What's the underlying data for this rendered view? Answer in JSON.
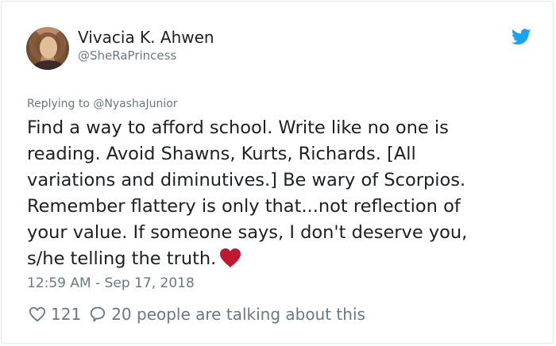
{
  "author": {
    "name": "Vivacia K. Ahwen",
    "handle": "@SheRaPrincess",
    "avatar_icon": "avatar-photo"
  },
  "brand": {
    "icon": "twitter-bird-icon",
    "color": "#1da1f2"
  },
  "tweet": {
    "replying_to": "Replying to @NyashaJunior",
    "lines": [
      "Find a way to afford school. Write like no one is",
      "reading. Avoid Shawns, Kurts, Richards. [All",
      "variations and diminutives.] Be wary of Scorpios.",
      "Remember flattery is only that...not reflection of",
      "your value. If someone says, I don't deserve you,",
      "s/he telling the truth."
    ],
    "emoji": "red-heart-icon",
    "emoji_color": "#be1931",
    "timestamp": "12:59 AM - Sep 17, 2018"
  },
  "actions": {
    "like_icon": "heart-outline-icon",
    "like_count": "121",
    "reply_icon": "speech-bubble-icon",
    "talking_text": "20 people are talking about this"
  }
}
